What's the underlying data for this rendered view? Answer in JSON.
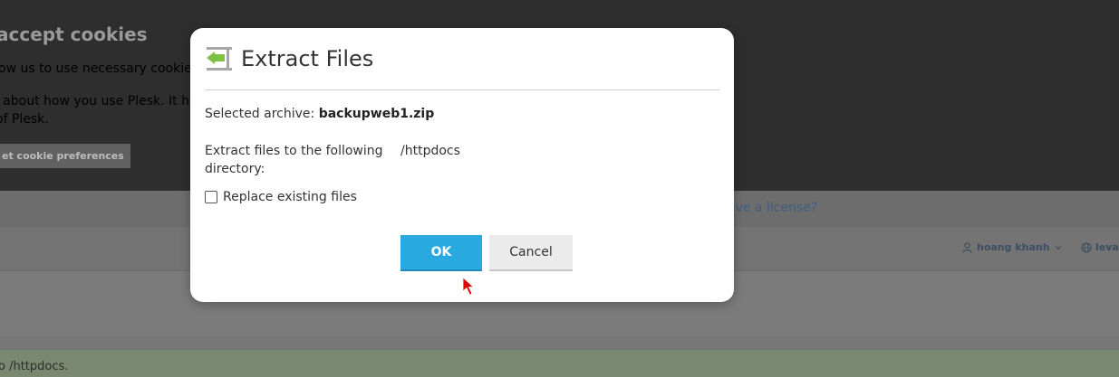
{
  "background": {
    "cookie_title": "accept cookies",
    "cookie_line1": "ow us to use necessary cookies.",
    "cookie_line2": "/ about how you use Plesk. It help",
    "cookie_line3": "of Plesk.",
    "cookie_button": "et cookie preferences",
    "license_link": "ave a license?",
    "user_name": "hoang khanh",
    "language": "leva",
    "message": "o /httpdocs."
  },
  "dialog": {
    "title": "Extract Files",
    "archive_label": "Selected archive: ",
    "archive_name": "backupweb1.zip",
    "extract_label": "Extract files to the following directory:",
    "extract_value": "/httpdocs",
    "replace_label": "Replace existing files",
    "replace_checked": false,
    "ok_label": "OK",
    "cancel_label": "Cancel"
  },
  "colors": {
    "accent": "#28aae1",
    "icon_green": "#7bc144",
    "cursor": "#e00000"
  }
}
